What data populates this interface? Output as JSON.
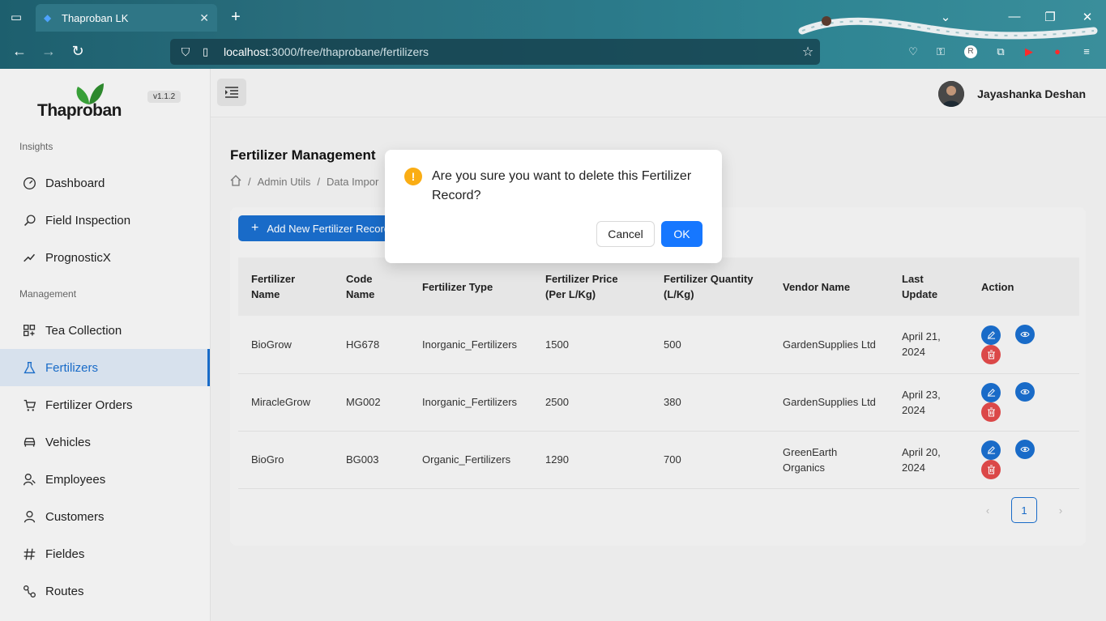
{
  "browser": {
    "tab_title": "Thaproban LK",
    "url_host": "localhost",
    "url_path": ":3000/free/thaprobane/fertilizers"
  },
  "sidebar": {
    "brand": "Thaproban",
    "version": "v1.1.2",
    "sections": {
      "insights": "Insights",
      "management": "Management"
    },
    "items": [
      {
        "label": "Dashboard",
        "icon": "dashboard-icon"
      },
      {
        "label": "Field Inspection",
        "icon": "search-icon"
      },
      {
        "label": "PrognosticX",
        "icon": "trend-icon"
      },
      {
        "label": "Tea Collection",
        "icon": "grid-icon"
      },
      {
        "label": "Fertilizers",
        "icon": "flask-icon",
        "active": true
      },
      {
        "label": "Fertilizer Orders",
        "icon": "cart-icon"
      },
      {
        "label": "Vehicles",
        "icon": "car-icon"
      },
      {
        "label": "Employees",
        "icon": "employees-icon"
      },
      {
        "label": "Customers",
        "icon": "user-icon"
      },
      {
        "label": "Fieldes",
        "icon": "hash-icon"
      },
      {
        "label": "Routes",
        "icon": "routes-icon"
      }
    ]
  },
  "header": {
    "user_name": "Jayashanka Deshan"
  },
  "main": {
    "title": "Fertilizer Management",
    "breadcrumb": [
      "Admin Utils",
      "Data Impor"
    ],
    "add_button": "Add New Fertilizer Record",
    "table": {
      "columns": [
        "Fertilizer Name",
        "Code Name",
        "Fertilizer Type",
        "Fertilizer Price (Per L/Kg)",
        "Fertilizer Quantity (L/Kg)",
        "Vendor Name",
        "Last Update",
        "Action"
      ],
      "rows": [
        {
          "name": "BioGrow",
          "code": "HG678",
          "type": "Inorganic_Fertilizers",
          "price": "1500",
          "qty": "500",
          "vendor": "GardenSupplies Ltd",
          "updated": "April 21, 2024"
        },
        {
          "name": "MiracleGrow",
          "code": "MG002",
          "type": "Inorganic_Fertilizers",
          "price": "2500",
          "qty": "380",
          "vendor": "GardenSupplies Ltd",
          "updated": "April 23, 2024"
        },
        {
          "name": "BioGro",
          "code": "BG003",
          "type": "Organic_Fertilizers",
          "price": "1290",
          "qty": "700",
          "vendor": "GreenEarth Organics",
          "updated": "April 20, 2024"
        }
      ]
    },
    "pagination": {
      "current": "1"
    }
  },
  "modal": {
    "message": "Are you sure you want to delete this Fertilizer Record?",
    "cancel_label": "Cancel",
    "ok_label": "OK"
  },
  "colors": {
    "accent": "#1a6ecc",
    "danger": "#e04a4a",
    "warning": "#faad14",
    "ok": "#1677ff"
  }
}
